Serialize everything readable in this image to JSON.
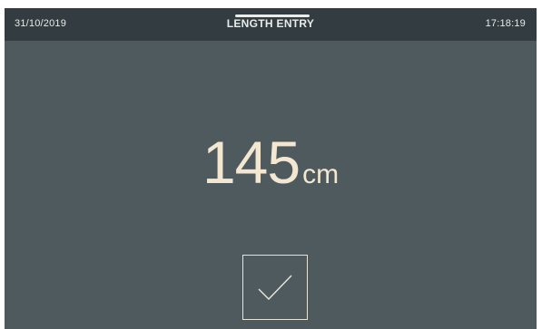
{
  "header": {
    "date": "31/10/2019",
    "title": "LENGTH ENTRY",
    "time": "17:18:19"
  },
  "readout": {
    "value": "145",
    "unit": "cm"
  },
  "confirm": {
    "icon": "check-icon"
  },
  "colors": {
    "background": "#4e5a5e",
    "header_background": "#333c40",
    "header_text": "#e8ebe7",
    "readout_text": "#f3e7d2",
    "button_border": "#e7e3d8"
  }
}
